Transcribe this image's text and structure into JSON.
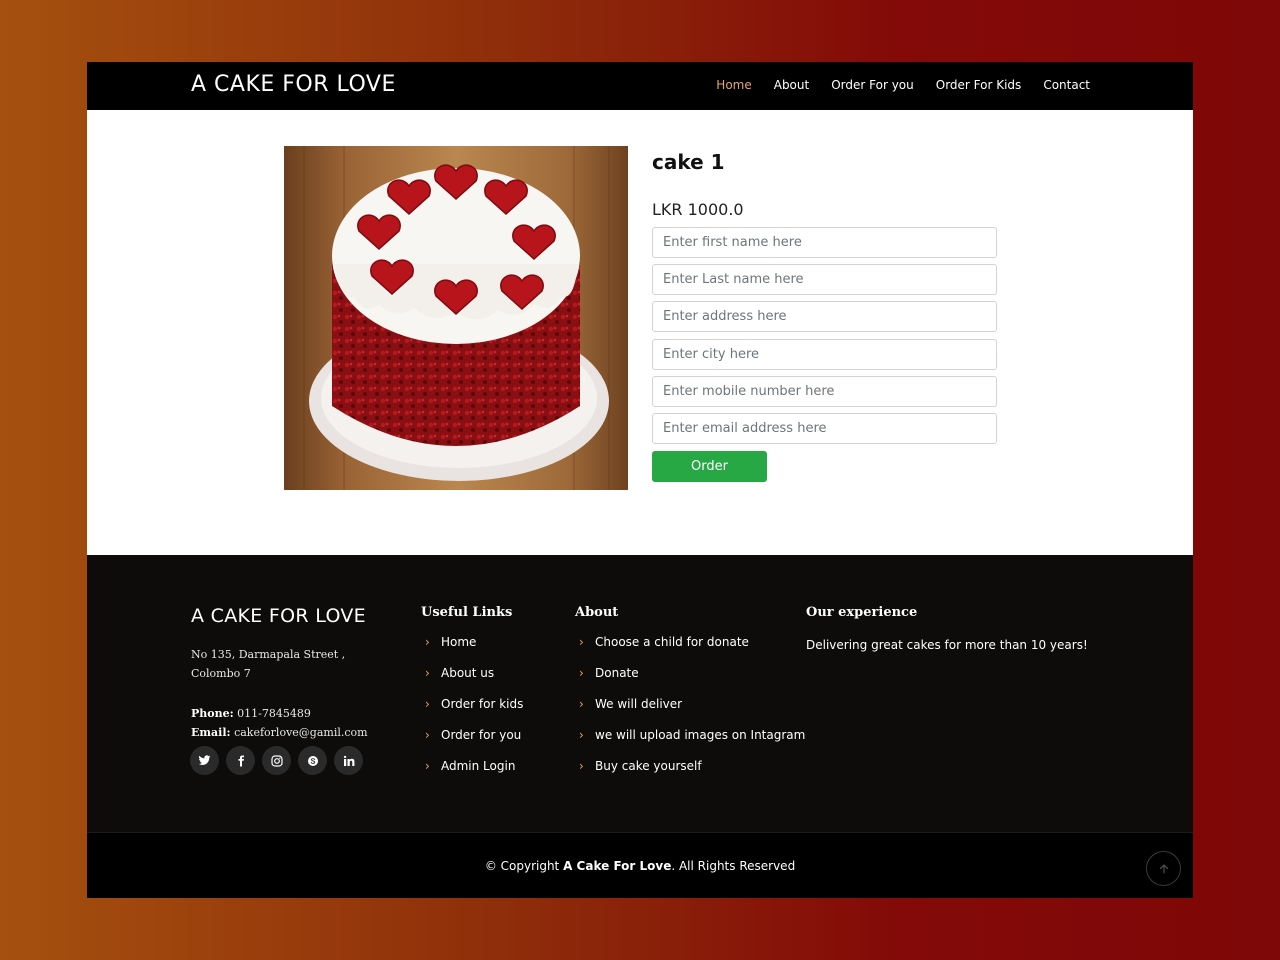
{
  "header": {
    "brand": "A CAKE FOR LOVE",
    "nav": [
      "Home",
      "About",
      "Order For you",
      "Order For Kids",
      "Contact"
    ],
    "active_nav": "Home"
  },
  "product": {
    "title": "cake 1",
    "price": "LKR 1000.0",
    "image": "red-velvet-heart-cake-photo",
    "fields": [
      "Enter first name here",
      "Enter Last name here",
      "Enter address here",
      "Enter city here",
      "Enter mobile number here",
      "Enter email address here"
    ],
    "order_label": "Order"
  },
  "footer": {
    "brand": "A CAKE FOR LOVE",
    "address_line1": "No 135, Darmapala Street ,",
    "address_line2": "Colombo 7",
    "phone_label": "Phone:",
    "phone": "011-7845489",
    "email_label": "Email:",
    "email": "cakeforlove@gamil.com",
    "socials": [
      "twitter-icon",
      "facebook-icon",
      "instagram-icon",
      "skype-icon",
      "linkedin-icon"
    ],
    "useful_links_title": "Useful Links",
    "useful_links": [
      "Home",
      "About us",
      "Order for kids",
      "Order for you",
      "Admin Login"
    ],
    "about_title": "About",
    "about_links": [
      "Choose a child for donate",
      "Donate",
      "We will deliver",
      "we will upload images on Intagram",
      "Buy cake yourself"
    ],
    "experience_title": "Our experience",
    "experience_text": "Delivering great cakes for more than 10 years!"
  },
  "bottom": {
    "copy_prefix": "© Copyright",
    "copy_brand": "A Cake For Love",
    "copy_suffix": ". All Rights Reserved"
  },
  "colors": {
    "accent": "#e4a66a",
    "order_button": "#28a745",
    "header_bg": "#000000",
    "footer_bg": "#0d0c0b"
  }
}
